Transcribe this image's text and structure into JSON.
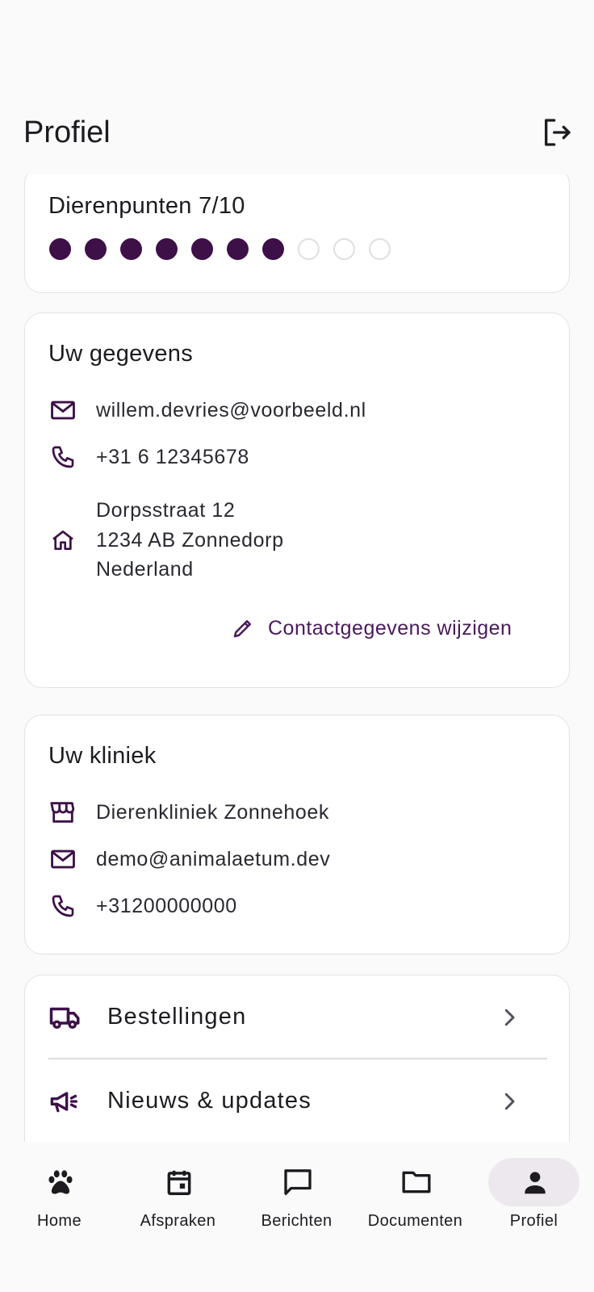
{
  "header": {
    "title": "Profiel"
  },
  "points": {
    "title": "Dierenpunten 7/10",
    "filled": 7,
    "total": 10
  },
  "details": {
    "title": "Uw gegevens",
    "email": "willem.devries@voorbeeld.nl",
    "phone": "+31 6 12345678",
    "address": [
      "Dorpsstraat 12",
      "1234 AB Zonnedorp",
      "Nederland"
    ],
    "edit_label": "Contactgegevens wijzigen"
  },
  "clinic": {
    "title": "Uw kliniek",
    "name": "Dierenkliniek Zonnehoek",
    "email": "demo@animalaetum.dev",
    "phone": "+31200000000"
  },
  "menu": {
    "items": [
      {
        "label": "Bestellingen",
        "icon": "truck-icon"
      },
      {
        "label": "Nieuws & updates",
        "icon": "megaphone-icon"
      }
    ]
  },
  "nav": {
    "items": [
      {
        "label": "Home",
        "icon": "paw-icon"
      },
      {
        "label": "Afspraken",
        "icon": "calendar-icon"
      },
      {
        "label": "Berichten",
        "icon": "chat-icon"
      },
      {
        "label": "Documenten",
        "icon": "folder-icon"
      },
      {
        "label": "Profiel",
        "icon": "person-icon"
      }
    ],
    "active": "Profiel"
  },
  "colors": {
    "accent": "#3d1048",
    "link": "#4a1a5c",
    "active_pill": "#ede8ee"
  }
}
